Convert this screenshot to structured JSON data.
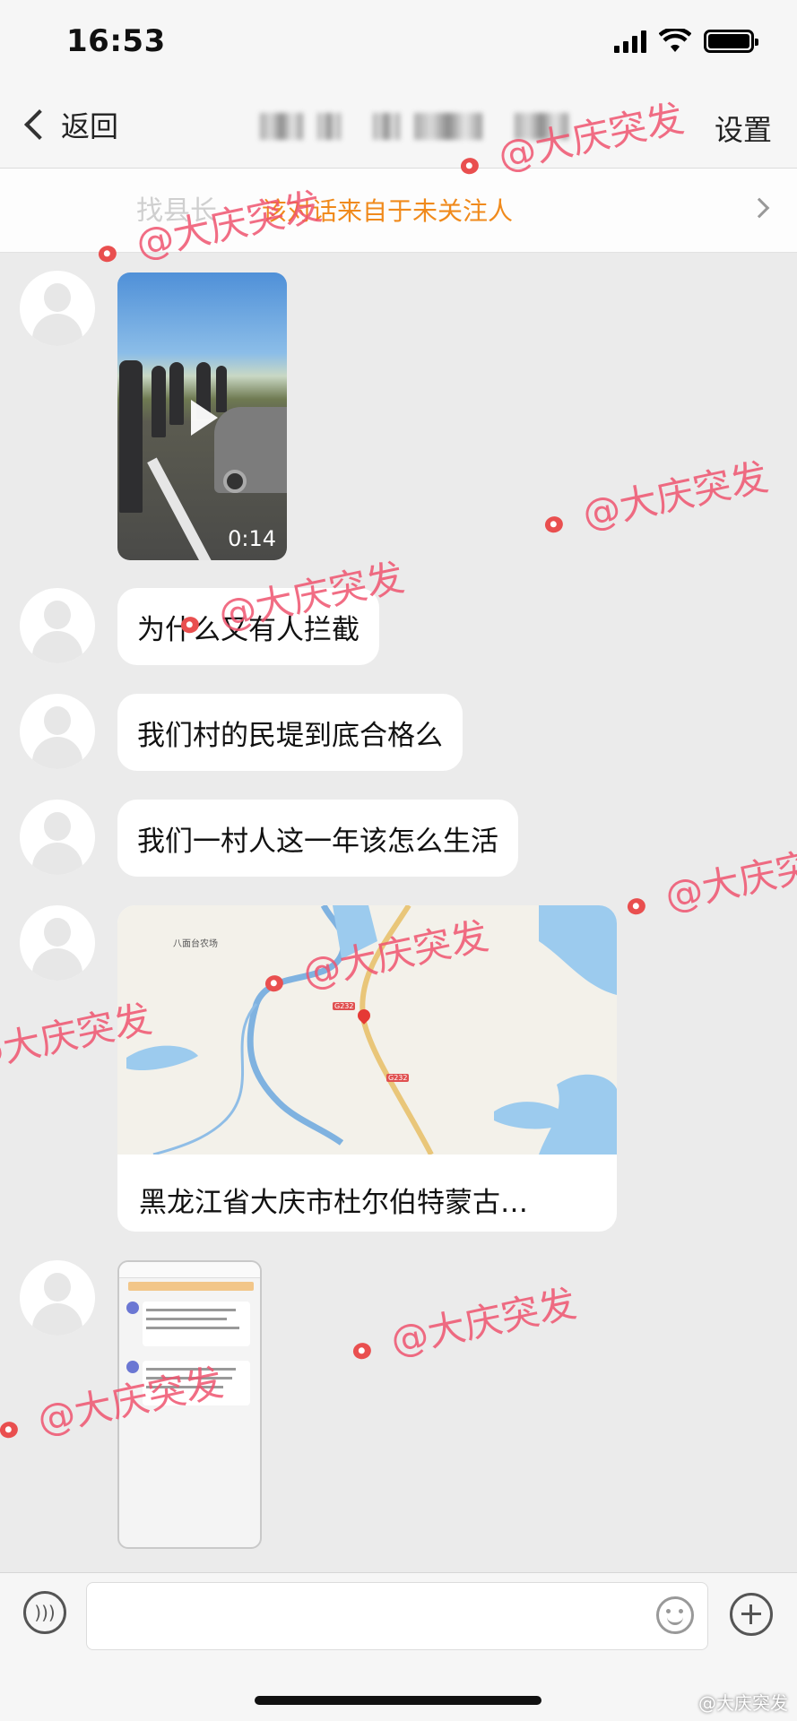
{
  "status_bar": {
    "time": "16:53"
  },
  "nav": {
    "back_label": "返回",
    "settings_label": "设置"
  },
  "notice": {
    "ghost_text": "找县长",
    "text": "该对话来自于未关注人"
  },
  "messages": {
    "video_duration": "0:14",
    "text1": "为什么又有人拦截",
    "text2": "我们村的民堤到底合格么",
    "text3": "我们一村人这一年该怎么生活",
    "location_address": "黑龙江省大庆市杜尔伯特蒙古…",
    "map_poi": "八面台农场",
    "map_road_1": "G232",
    "map_road_2": "G232"
  },
  "input": {
    "placeholder": ""
  },
  "watermark": {
    "text": "@大庆突发"
  },
  "weibo_credit": "@大庆突发",
  "colors": {
    "notice_text": "#f08a1c",
    "watermark": "#ef536e",
    "background": "#ebebeb"
  },
  "icons": [
    "back-chevron-icon",
    "signal-icon",
    "wifi-icon",
    "battery-icon",
    "play-icon",
    "voice-icon",
    "emoji-icon",
    "add-icon",
    "map-pin-icon",
    "weibo-logo-icon"
  ]
}
